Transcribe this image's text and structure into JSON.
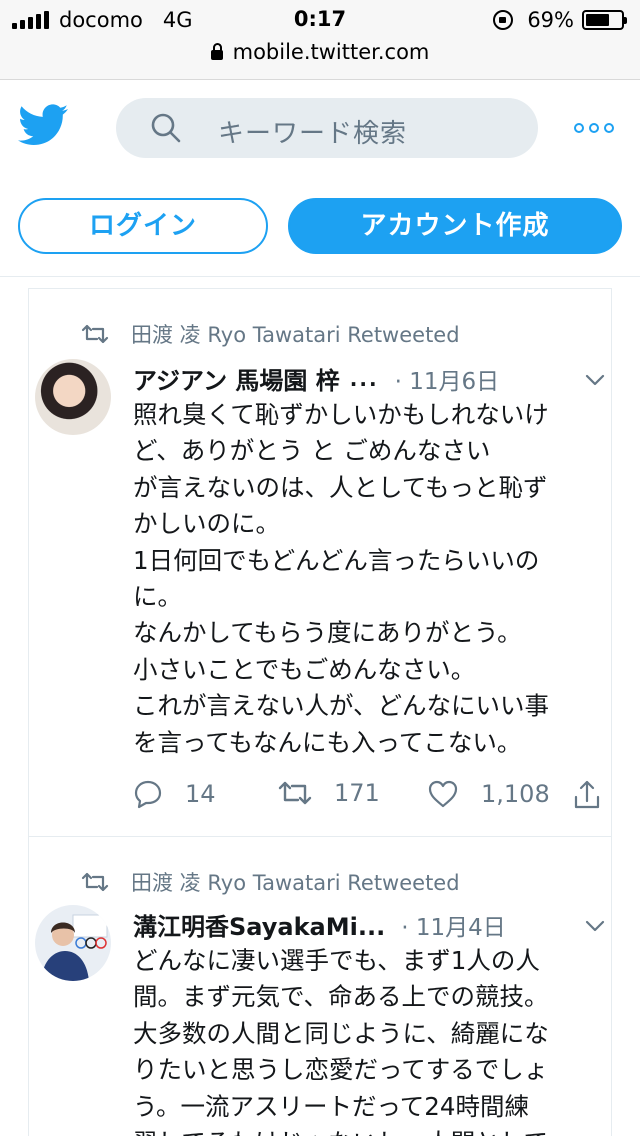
{
  "status_bar": {
    "carrier": "docomo",
    "network": "4G",
    "time": "0:17",
    "battery_percent": "69%",
    "battery_level": 0.69
  },
  "browser": {
    "url": "mobile.twitter.com"
  },
  "header": {
    "logo_icon": "twitter-bird-icon",
    "search_placeholder": "キーワード検索",
    "more_icon": "more-dots-icon"
  },
  "auth": {
    "login_label": "ログイン",
    "signup_label": "アカウント作成"
  },
  "colors": {
    "brand": "#1da1f2",
    "secondary_text": "#657786",
    "search_bg": "#e6ecf0"
  },
  "tweets": [
    {
      "retweeted_by": "田渡 凌 Ryo Tawatari Retweeted",
      "author": "アジアン 馬場園 梓",
      "ellipsis": "...",
      "date": "· 11月6日",
      "text": "照れ臭くて恥ずかしいかもしれないけ\nど、ありがとう と ごめんなさい\nが言えないのは、人としてもっと恥ず\nかしいのに。\n1日何回でもどんどん言ったらいいの\nに。\nなんかしてもらう度にありがとう。\n小さいことでもごめんなさい。\nこれが言えない人が、どんなにいい事\nを言ってもなんにも入ってこない。",
      "replies": "14",
      "retweets": "171",
      "likes": "1,108"
    },
    {
      "retweeted_by": "田渡 凌 Ryo Tawatari Retweeted",
      "author": "溝江明香SayakaMi...",
      "date": "· 11月4日",
      "text": "どんなに凄い選手でも、まず1人の人\n間。まず元気で、命ある上での競技。\n大多数の人間と同じように、綺麗にな\nりたいと思うし恋愛だってするでしょ\nう。一流アスリートだって24時間練\n習してるわけじゃないし、人間として"
    }
  ]
}
